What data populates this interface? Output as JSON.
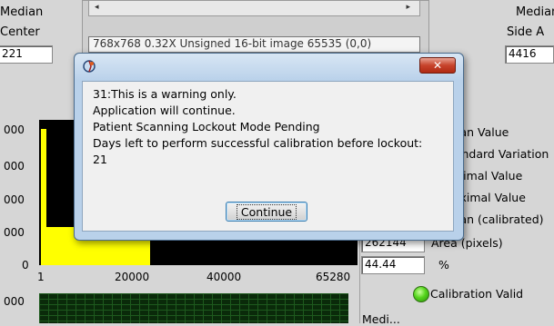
{
  "background": {
    "left_labels": [
      "Median",
      "Center"
    ],
    "left_value": "221",
    "right_labels": [
      "Median",
      "Side A"
    ],
    "right_value": "4416",
    "image_info": "768x768 0.32X Unsigned 16-bit image 65535 (0,0)",
    "scroll_left_arrow": "◂",
    "scroll_right_arrow": "▸"
  },
  "histogram": {
    "y_tick_labels": [
      "000",
      "000",
      "000",
      "000",
      "0"
    ],
    "x_tick_labels": [
      "1",
      "20000",
      "40000",
      "65280"
    ],
    "lower_y_tick": "000"
  },
  "stats": {
    "labels": [
      "Mean Value",
      "Standard Variation",
      "Minimal Value",
      "Maximal Value",
      "Mean (calibrated)"
    ],
    "area_value": "262144",
    "area_label": "Area (pixels)",
    "percent_value": "44.44",
    "percent_label": "%",
    "calibration_label": "Calibration Valid",
    "bottom_label": "Medi..."
  },
  "dialog": {
    "title": "",
    "close_symbol": "✕",
    "message_lines": [
      "31:This is a warning only.",
      "Application will continue.",
      "Patient Scanning Lockout Mode Pending",
      "Days left to perform successful calibration before lockout:",
      "21"
    ],
    "button_label": "Continue"
  }
}
